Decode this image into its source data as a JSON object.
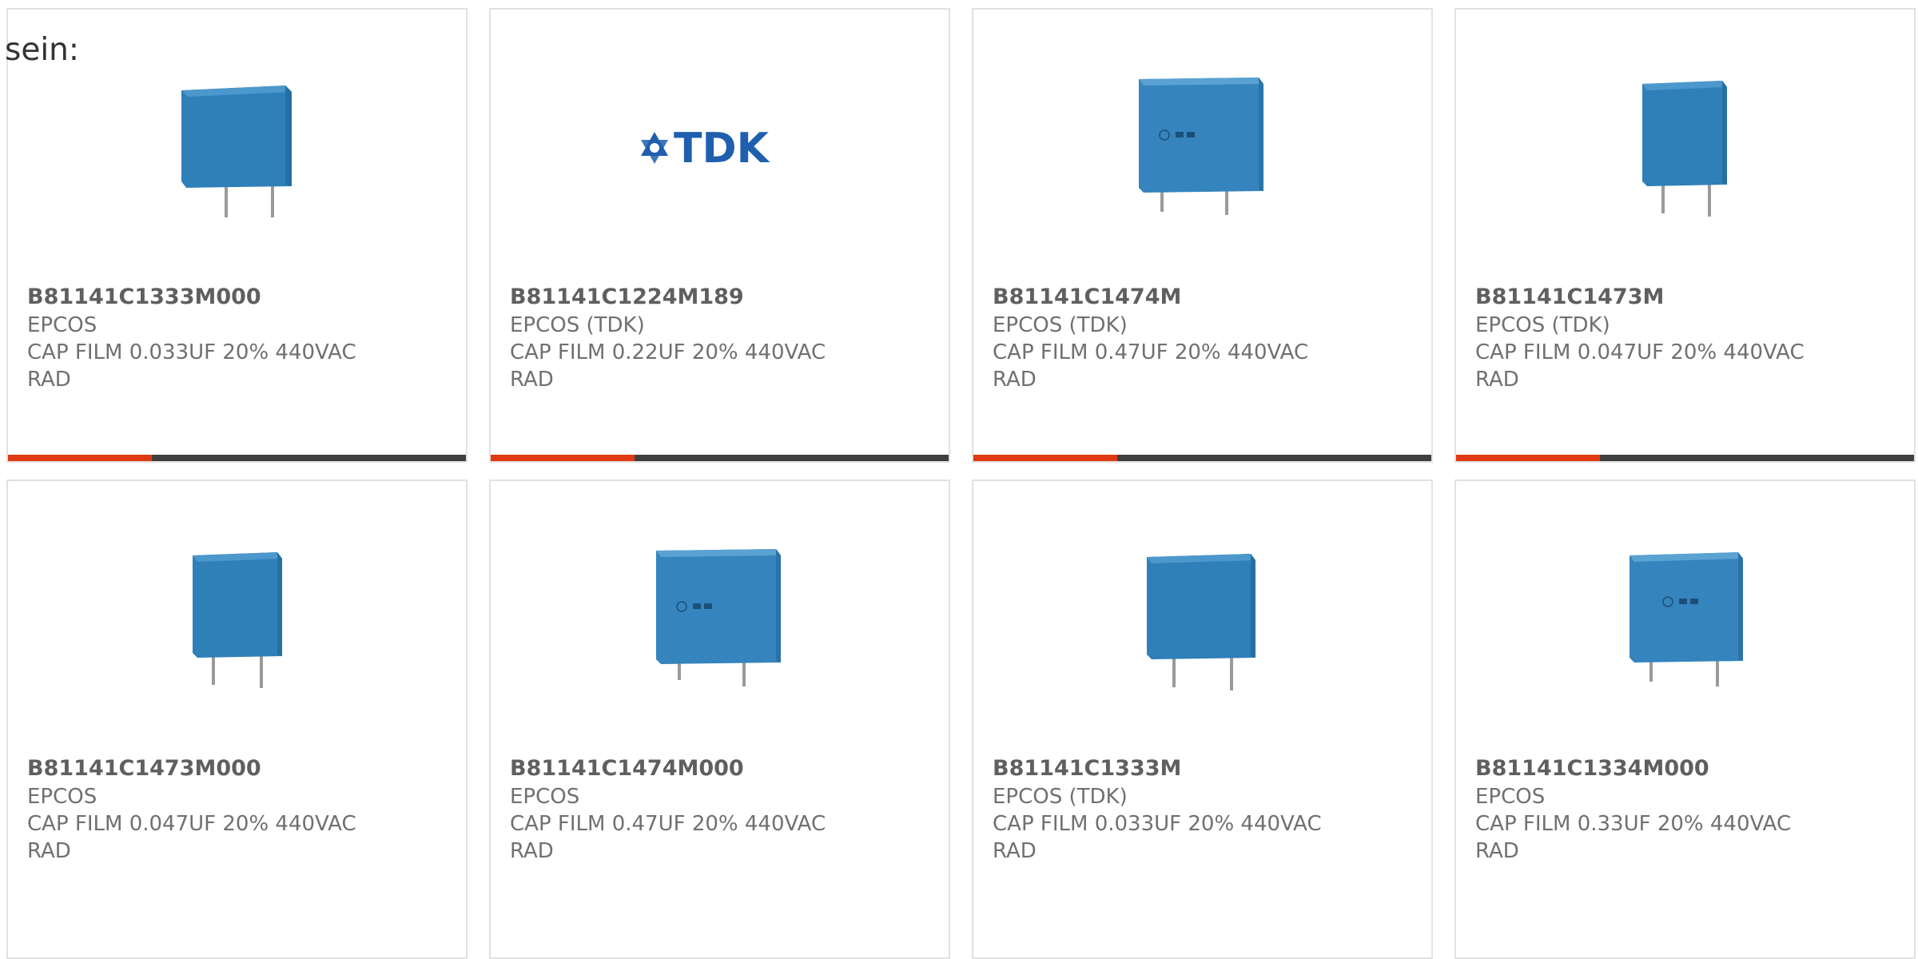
{
  "intro_text": "sein:",
  "colors": {
    "accent": "#e03a12",
    "bar": "#3f3f3f",
    "capacitor_blue": "#2e7fb8",
    "tdk_blue": "#1f5fae"
  },
  "products": [
    {
      "part": "B81141C1333M000",
      "manufacturer": "EPCOS",
      "desc_line1": "CAP FILM 0.033UF 20% 440VAC",
      "desc_line2": "RAD",
      "image": "capacitor-plain-small",
      "accent_fraction": 0.315
    },
    {
      "part": "B81141C1224M189",
      "manufacturer": "EPCOS (TDK)",
      "desc_line1": "CAP FILM 0.22UF 20% 440VAC",
      "desc_line2": "RAD",
      "image": "tdk-logo",
      "logo_text": "TDK",
      "accent_fraction": 0.315
    },
    {
      "part": "B81141C1474M",
      "manufacturer": "EPCOS (TDK)",
      "desc_line1": "CAP FILM 0.47UF 20% 440VAC",
      "desc_line2": "RAD",
      "image": "capacitor-marked-large",
      "accent_fraction": 0.315
    },
    {
      "part": "B81141C1473M",
      "manufacturer": "EPCOS (TDK)",
      "desc_line1": "CAP FILM 0.047UF 20% 440VAC",
      "desc_line2": "RAD",
      "image": "capacitor-plain-narrow",
      "accent_fraction": 0.315
    },
    {
      "part": "B81141C1473M000",
      "manufacturer": "EPCOS",
      "desc_line1": "CAP FILM 0.047UF 20% 440VAC",
      "desc_line2": "RAD",
      "image": "capacitor-plain-narrow",
      "accent_fraction": 0
    },
    {
      "part": "B81141C1474M000",
      "manufacturer": "EPCOS",
      "desc_line1": "CAP FILM 0.47UF 20% 440VAC",
      "desc_line2": "RAD",
      "image": "capacitor-marked-large",
      "accent_fraction": 0
    },
    {
      "part": "B81141C1333M",
      "manufacturer": "EPCOS (TDK)",
      "desc_line1": "CAP FILM 0.033UF 20% 440VAC",
      "desc_line2": "RAD",
      "image": "capacitor-plain-medium",
      "accent_fraction": 0
    },
    {
      "part": "B81141C1334M000",
      "manufacturer": "EPCOS",
      "desc_line1": "CAP FILM 0.33UF 20% 440VAC",
      "desc_line2": "RAD",
      "image": "capacitor-marked-medium",
      "accent_fraction": 0
    }
  ]
}
